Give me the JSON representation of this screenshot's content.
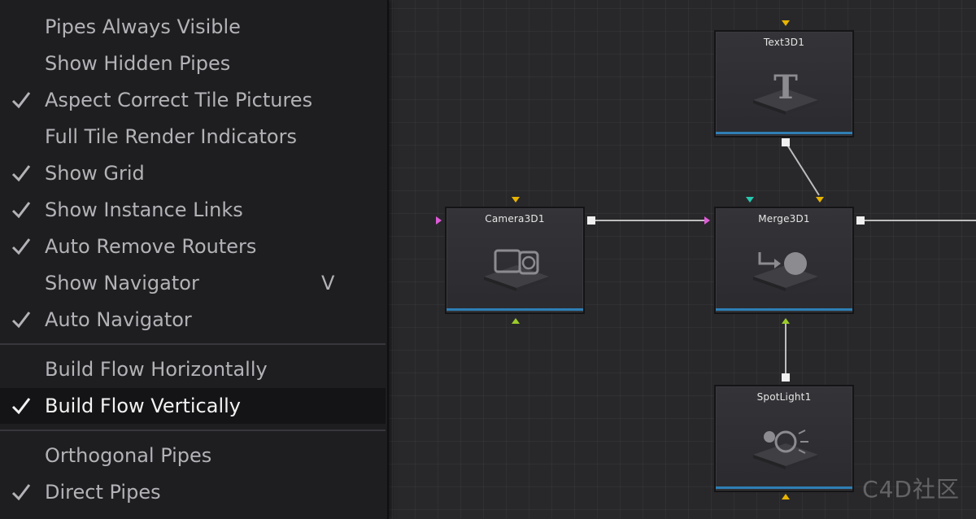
{
  "menu": {
    "group1": [
      {
        "label": "Pipes Always Visible",
        "checked": false
      },
      {
        "label": "Show Hidden Pipes",
        "checked": false
      },
      {
        "label": "Aspect Correct Tile Pictures",
        "checked": true
      },
      {
        "label": "Full Tile Render Indicators",
        "checked": false
      },
      {
        "label": "Show Grid",
        "checked": true
      },
      {
        "label": "Show Instance Links",
        "checked": true
      },
      {
        "label": "Auto Remove Routers",
        "checked": true
      },
      {
        "label": "Show Navigator",
        "checked": false,
        "shortcut": "V"
      },
      {
        "label": "Auto Navigator",
        "checked": true
      }
    ],
    "group2": [
      {
        "label": "Build Flow Horizontally",
        "checked": false
      },
      {
        "label": "Build Flow Vertically",
        "checked": true,
        "highlighted": true
      }
    ],
    "group3": [
      {
        "label": "Orthogonal Pipes",
        "checked": false
      },
      {
        "label": "Direct Pipes",
        "checked": true
      }
    ]
  },
  "nodes": {
    "text3d": {
      "title": "Text3D1",
      "icon": "text3d-icon"
    },
    "camera3d": {
      "title": "Camera3D1",
      "icon": "camera3d-icon"
    },
    "merge3d": {
      "title": "Merge3D1",
      "icon": "merge3d-icon"
    },
    "spotlight": {
      "title": "SpotLight1",
      "icon": "spotlight-icon"
    }
  },
  "colors": {
    "accent_bar": "#2f7fb5",
    "input_yellow": "#e8b400",
    "input_magenta": "#e05bd8",
    "input_cyan": "#27c9b0",
    "output_green": "#9ccc2a"
  },
  "watermark": "C4D社区"
}
